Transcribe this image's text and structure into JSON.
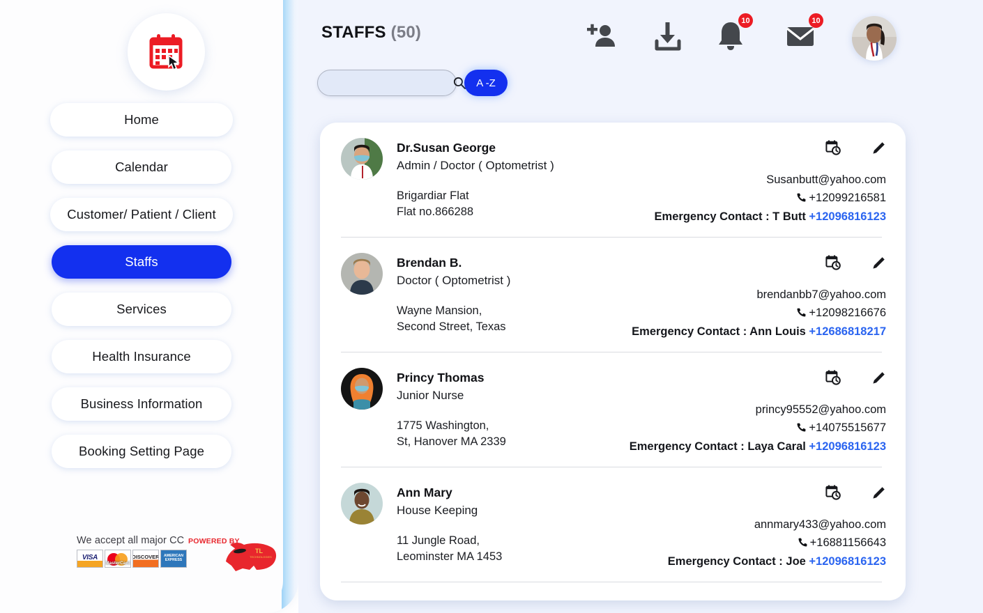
{
  "sidebar": {
    "logo_icon": "calendar-click-icon",
    "items": [
      {
        "label": "Home",
        "active": false,
        "width_class": "w1"
      },
      {
        "label": "Calendar",
        "active": false,
        "width_class": "w2"
      },
      {
        "label": "Customer/ Patient / Client",
        "active": false,
        "width_class": "w3"
      },
      {
        "label": "Staffs",
        "active": true,
        "width_class": "w2"
      },
      {
        "label": "Services",
        "active": false,
        "width_class": "w2"
      },
      {
        "label": "Health Insurance",
        "active": false,
        "width_class": "w2"
      },
      {
        "label": "Business Information",
        "active": false,
        "width_class": "w2"
      },
      {
        "label": "Booking Setting Page",
        "active": false,
        "width_class": "w2"
      }
    ],
    "footer": {
      "cc_label": "We accept all major CC",
      "cards": [
        "VISA",
        "MasterCard",
        "DISCOVER",
        "AMERICAN EXPRESS"
      ],
      "powered_by_text": "POWERED BY",
      "powered_by_logo": "bull-logo"
    }
  },
  "header": {
    "title": "STAFFS",
    "count": "(50)",
    "actions": [
      {
        "icon": "add-person-icon",
        "badge": null
      },
      {
        "icon": "download-icon",
        "badge": null
      },
      {
        "icon": "bell-icon",
        "badge": "10"
      },
      {
        "icon": "mail-icon",
        "badge": "10"
      }
    ],
    "avatar_icon": "user-avatar"
  },
  "search": {
    "value": "",
    "placeholder": "",
    "icon": "search-icon",
    "sort_button_label": "A -Z"
  },
  "colors": {
    "accent_blue": "#1330ef",
    "link_blue": "#2a64f0",
    "badge_red": "#ec1c24",
    "main_bg": "#f1f4fd",
    "logo_red": "#ec1c24"
  },
  "staff_list": [
    {
      "name": "Dr.Susan George",
      "role": "Admin / Doctor ( Optometrist )",
      "address": "Brigardiar Flat\nFlat no.866288",
      "email": "Susanbutt@yahoo.com",
      "phone": "+12099216581",
      "emergency_label": "Emergency Contact : T Butt",
      "emergency_phone": "+12096816123",
      "avatar_icon": "staff-avatar-susan",
      "calendar_action": "schedule-icon",
      "edit_action": "edit-pencil-icon"
    },
    {
      "name": "Brendan B.",
      "role": " Doctor ( Optometrist )",
      "address": "Wayne Mansion,\nSecond Street, Texas",
      "email": "brendanbb7@yahoo.com",
      "phone": "+12098216676",
      "emergency_label": "Emergency Contact : Ann Louis",
      "emergency_phone": "+12686818217",
      "avatar_icon": "staff-avatar-brendan",
      "calendar_action": "schedule-icon",
      "edit_action": "edit-pencil-icon"
    },
    {
      "name": "Princy Thomas",
      "role": "Junior Nurse",
      "address": "1775 Washington,\n St, Hanover MA 2339",
      "email": "princy95552@yahoo.com",
      "phone": "+14075515677",
      "emergency_label": "Emergency Contact : Laya Caral",
      "emergency_phone": "+12096816123",
      "avatar_icon": "staff-avatar-princy",
      "calendar_action": "schedule-icon",
      "edit_action": "edit-pencil-icon"
    },
    {
      "name": "Ann Mary",
      "role": "House Keeping",
      "address": "11 Jungle Road,\n Leominster MA 1453",
      "email": "annmary433@yahoo.com",
      "phone": "+16881156643",
      "emergency_label": "Emergency Contact : Joe",
      "emergency_phone": "+12096816123",
      "avatar_icon": "staff-avatar-annmary",
      "calendar_action": "schedule-icon",
      "edit_action": "edit-pencil-icon"
    }
  ]
}
